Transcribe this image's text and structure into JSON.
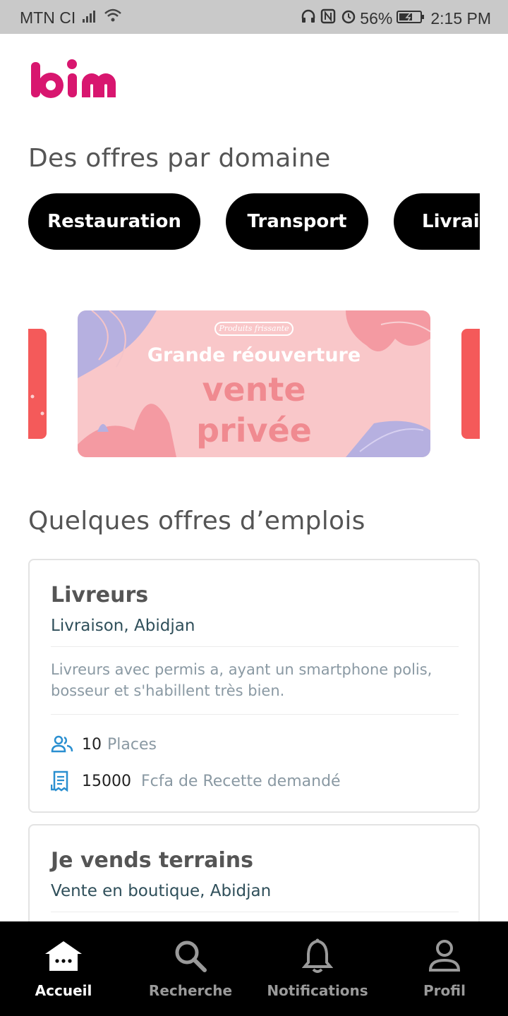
{
  "status_bar": {
    "carrier": "MTN CI",
    "battery": "56%",
    "time": "2:15 PM"
  },
  "brand": {
    "name": "bim",
    "color": "#d8166f"
  },
  "sections": {
    "domains_title": "Des offres par domaine",
    "jobs_title": "Quelques offres d’emplois"
  },
  "categories": [
    {
      "label": "Restauration"
    },
    {
      "label": "Transport"
    },
    {
      "label": "Livrais"
    }
  ],
  "banner": {
    "tag": "Produits frissante",
    "title": "Grande réouverture",
    "line1": "vente",
    "line2": "privée"
  },
  "jobs": [
    {
      "title": "Livreurs",
      "subtitle": "Livraison, Abidjan",
      "description": "Livreurs avec permis a, ayant un smartphone polis, bosseur et s'habillent très bien.",
      "places_value": "10",
      "places_label": "Places",
      "revenue_value": "15000",
      "revenue_label": "Fcfa de Recette demandé"
    },
    {
      "title": "Je vends terrains",
      "subtitle": "Vente en boutique, Abidjan"
    }
  ],
  "nav": [
    {
      "label": "Accueil",
      "icon": "home-icon",
      "active": true
    },
    {
      "label": "Recherche",
      "icon": "search-icon",
      "active": false
    },
    {
      "label": "Notifications",
      "icon": "bell-icon",
      "active": false
    },
    {
      "label": "Profil",
      "icon": "person-icon",
      "active": false
    }
  ],
  "colors": {
    "accent": "#d8166f",
    "chip_bg": "#000000",
    "icon_blue": "#2a8fd0",
    "banner_pink": "#f9c7c9"
  }
}
